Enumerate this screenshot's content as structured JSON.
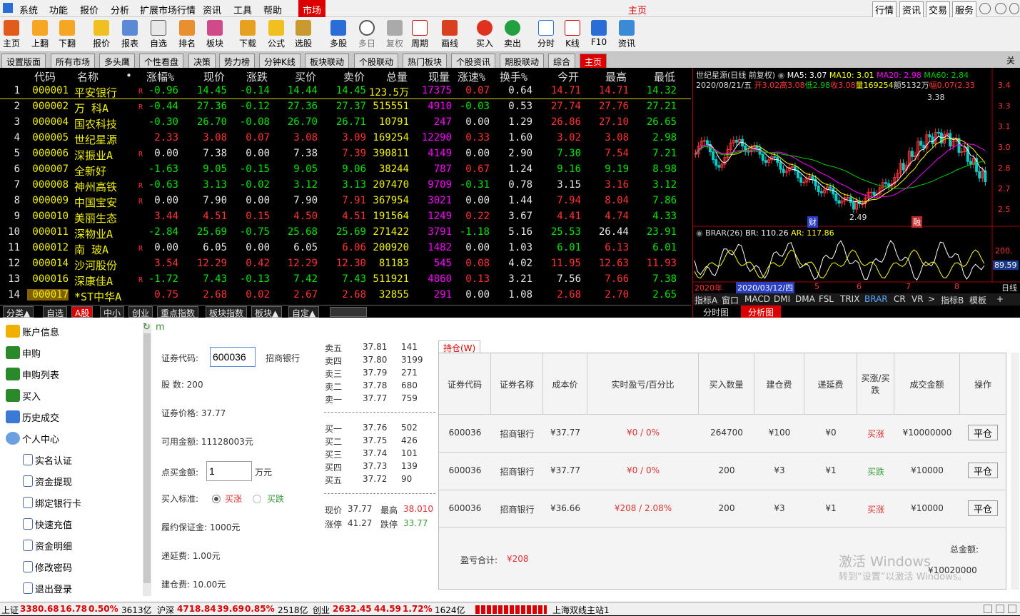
{
  "menu": [
    "系统",
    "功能",
    "报价",
    "分析",
    "扩展市场行情",
    "资讯",
    "工具",
    "帮助"
  ],
  "market_tab": "市场",
  "window_title": "主页",
  "right_menu": [
    "行情",
    "资讯",
    "交易",
    "服务"
  ],
  "toolbar": [
    "主页",
    "上翻",
    "下翻",
    "报价",
    "报表",
    "自选",
    "排名",
    "板块",
    "下载",
    "公式",
    "选股",
    "多股",
    "多日",
    "复权",
    "周期",
    "画线",
    "买入",
    "卖出",
    "分时",
    "K线",
    "F10",
    "资讯"
  ],
  "tabs": [
    "设置版面",
    "所有市场",
    "多头鹰",
    "个性看盘",
    "决策",
    "势力榜",
    "分钟K线",
    "板块联动",
    "个股联动",
    "热门板块",
    "个股资讯",
    "期股联动",
    "综合",
    "主页"
  ],
  "corner_label": "关",
  "grid": {
    "headers": [
      "代码",
      "名称",
      "•",
      "涨幅%",
      "现价",
      "涨跌",
      "买价",
      "卖价",
      "总量",
      "现量",
      "涨速%",
      "换手%",
      "今开",
      "最高",
      "最低"
    ],
    "rows": [
      {
        "n": "1",
        "code": "000001",
        "name": "平安银行",
        "r": "R",
        "pct": "-0.96",
        "price": "14.45",
        "chg": "-0.14",
        "bid": "14.44",
        "ask": "14.45",
        "vol": "123.5万",
        "cur": "17375",
        "spd": "0.07",
        "turn": "0.64",
        "open": "14.71",
        "high": "14.71",
        "low": "14.32"
      },
      {
        "n": "2",
        "code": "000002",
        "name": "万 科A",
        "r": "R",
        "pct": "-0.44",
        "price": "27.36",
        "chg": "-0.12",
        "bid": "27.36",
        "ask": "27.37",
        "vol": "515551",
        "cur": "4910",
        "spd": "-0.03",
        "turn": "0.53",
        "open": "27.74",
        "high": "27.76",
        "low": "27.21"
      },
      {
        "n": "3",
        "code": "000004",
        "name": "国农科技",
        "r": "",
        "pct": "-0.30",
        "price": "26.70",
        "chg": "-0.08",
        "bid": "26.70",
        "ask": "26.71",
        "vol": "10791",
        "cur": "247",
        "spd": "0.00",
        "turn": "1.29",
        "open": "26.86",
        "high": "27.10",
        "low": "26.65"
      },
      {
        "n": "4",
        "code": "000005",
        "name": "世纪星源",
        "r": "",
        "pct": "2.33",
        "price": "3.08",
        "chg": "0.07",
        "bid": "3.08",
        "ask": "3.09",
        "vol": "169254",
        "cur": "12290",
        "spd": "0.33",
        "turn": "1.60",
        "open": "3.02",
        "high": "3.08",
        "low": "2.98"
      },
      {
        "n": "5",
        "code": "000006",
        "name": "深振业A",
        "r": "R",
        "pct": "0.00",
        "price": "7.38",
        "chg": "0.00",
        "bid": "7.38",
        "ask": "7.39",
        "vol": "390811",
        "cur": "4149",
        "spd": "0.00",
        "turn": "2.90",
        "open": "7.30",
        "high": "7.54",
        "low": "7.21"
      },
      {
        "n": "6",
        "code": "000007",
        "name": "全新好",
        "r": "",
        "pct": "-1.63",
        "price": "9.05",
        "chg": "-0.15",
        "bid": "9.05",
        "ask": "9.06",
        "vol": "38244",
        "cur": "787",
        "spd": "0.67",
        "turn": "1.24",
        "open": "9.16",
        "high": "9.19",
        "low": "8.98"
      },
      {
        "n": "7",
        "code": "000008",
        "name": "神州高铁",
        "r": "R",
        "pct": "-0.63",
        "price": "3.13",
        "chg": "-0.02",
        "bid": "3.12",
        "ask": "3.13",
        "vol": "207470",
        "cur": "9709",
        "spd": "-0.31",
        "turn": "0.78",
        "open": "3.15",
        "high": "3.16",
        "low": "3.12"
      },
      {
        "n": "8",
        "code": "000009",
        "name": "中国宝安",
        "r": "R",
        "pct": "0.00",
        "price": "7.90",
        "chg": "0.00",
        "bid": "7.90",
        "ask": "7.91",
        "vol": "367954",
        "cur": "3021",
        "spd": "0.00",
        "turn": "1.44",
        "open": "7.94",
        "high": "8.04",
        "low": "7.86"
      },
      {
        "n": "9",
        "code": "000010",
        "name": "美丽生态",
        "r": "",
        "pct": "3.44",
        "price": "4.51",
        "chg": "0.15",
        "bid": "4.50",
        "ask": "4.51",
        "vol": "191564",
        "cur": "1249",
        "spd": "0.22",
        "turn": "3.67",
        "open": "4.41",
        "high": "4.74",
        "low": "4.33"
      },
      {
        "n": "10",
        "code": "000011",
        "name": "深物业A",
        "r": "",
        "pct": "-2.84",
        "price": "25.69",
        "chg": "-0.75",
        "bid": "25.68",
        "ask": "25.69",
        "vol": "271422",
        "cur": "3791",
        "spd": "-1.18",
        "turn": "5.16",
        "open": "25.53",
        "high": "26.44",
        "low": "23.91"
      },
      {
        "n": "11",
        "code": "000012",
        "name": "南 玻A",
        "r": "R",
        "pct": "0.00",
        "price": "6.05",
        "chg": "0.00",
        "bid": "6.05",
        "ask": "6.06",
        "vol": "200920",
        "cur": "1482",
        "spd": "0.00",
        "turn": "1.03",
        "open": "6.01",
        "high": "6.13",
        "low": "6.01"
      },
      {
        "n": "12",
        "code": "000014",
        "name": "沙河股份",
        "r": "",
        "pct": "3.54",
        "price": "12.29",
        "chg": "0.42",
        "bid": "12.29",
        "ask": "12.30",
        "vol": "81183",
        "cur": "545",
        "spd": "0.08",
        "turn": "4.02",
        "open": "11.95",
        "high": "12.63",
        "low": "11.93"
      },
      {
        "n": "13",
        "code": "000016",
        "name": "深康佳A",
        "r": "R",
        "pct": "-1.72",
        "price": "7.43",
        "chg": "-0.13",
        "bid": "7.42",
        "ask": "7.43",
        "vol": "511921",
        "cur": "4860",
        "spd": "0.13",
        "turn": "3.21",
        "open": "7.56",
        "high": "7.66",
        "low": "7.38"
      },
      {
        "n": "14",
        "code": "000017",
        "name": "*ST中华A",
        "r": "",
        "pct": "0.75",
        "price": "2.68",
        "chg": "0.02",
        "bid": "2.67",
        "ask": "2.68",
        "vol": "32855",
        "cur": "291",
        "spd": "0.00",
        "turn": "1.08",
        "open": "2.68",
        "high": "2.70",
        "low": "2.65"
      }
    ]
  },
  "bottom_tabs": [
    "分类▲",
    "自选",
    "A股",
    "中小",
    "创业",
    "重点指数",
    "板块指数",
    "板块▲",
    "自定▲"
  ],
  "chart": {
    "title": "世纪星源(日线 前复权)",
    "ma5": "MA5: 3.07",
    "ma10": "MA10: 3.01",
    "ma20": "MA20: 2.98",
    "ma60": "MA60: 2.84",
    "info_date": "2020/08/21/五",
    "info_open": "开3.02",
    "info_high": "高3.08",
    "info_low": "低2.98",
    "info_close": "收3.08",
    "info_vol": "量169254",
    "info_amt": "额5132万",
    "info_pct": "幅0.07(2.33",
    "max_label": "3.38",
    "min_label": "2.49",
    "mark1": "财",
    "mark2": "融",
    "yticks": [
      "3.4",
      "3.3",
      "3.1",
      "3.0",
      "2.8",
      "2.7",
      "2.5"
    ],
    "brar": "BRAR(26)",
    "br": "BR: 110.26",
    "ar": "AR: 117.86",
    "brar_tick": "200.",
    "brar_cur": "89.59",
    "xaxis": [
      "2020年",
      "2020/03/12/四",
      "5",
      "6",
      "7",
      "8"
    ],
    "xaxis_right": "日线",
    "ind_tabs": [
      "指标A",
      "窗口",
      "MACD",
      "DMI",
      "DMA",
      "FSL",
      "TRIX",
      "BRAR",
      "CR",
      "VR",
      ">",
      "指标B",
      "模板",
      "+"
    ],
    "view_tabs": [
      "分时图",
      "分析图"
    ]
  },
  "sidebar": [
    "账户信息",
    "申购",
    "申购列表",
    "买入",
    "历史成交",
    "个人中心",
    "实名认证",
    "资金提现",
    "绑定银行卡",
    "快速充值",
    "资金明细",
    "修改密码",
    "退出登录"
  ],
  "form": {
    "code_label": "证券代码:",
    "code_value": "600036",
    "code_name": "招商银行",
    "shares": "股 数:  200",
    "price": "证券价格:   37.77",
    "avail": "可用金额:   11128003元",
    "amount_label": "点买金额:",
    "amount_value": "1",
    "amount_unit": "万元",
    "std_label": "买入标准:",
    "std_up": "买涨",
    "std_down": "买跌",
    "deposit": "履约保证金:    1000元",
    "defer": "递延费:    1.00元",
    "build": "建仓费:    10.00元"
  },
  "orderbook": {
    "sell": [
      [
        "卖五",
        "37.81",
        "141"
      ],
      [
        "卖四",
        "37.80",
        "3199"
      ],
      [
        "卖三",
        "37.79",
        "271"
      ],
      [
        "卖二",
        "37.78",
        "680"
      ],
      [
        "卖一",
        "37.77",
        "759"
      ]
    ],
    "buy": [
      [
        "买一",
        "37.76",
        "502"
      ],
      [
        "买二",
        "37.75",
        "426"
      ],
      [
        "买三",
        "37.74",
        "101"
      ],
      [
        "买四",
        "37.73",
        "139"
      ],
      [
        "买五",
        "37.72",
        "90"
      ]
    ],
    "now_label": "现价",
    "now": "37.77",
    "high_label": "最高",
    "high": "38.010",
    "up_label": "涨停",
    "up": "41.27",
    "down_label": "跌停",
    "down": "33.77"
  },
  "positions": {
    "tab": "持仓(W)",
    "headers": [
      "证券代码",
      "证券名称",
      "成本价",
      "实时盈亏/百分比",
      "买入数量",
      "建仓费",
      "递延费",
      "买涨/买跌",
      "成交金额",
      "操作"
    ],
    "rows": [
      {
        "code": "600036",
        "name": "招商银行",
        "cost": "¥37.77",
        "pl": "¥0 / 0%",
        "qty": "264700",
        "build": "¥100",
        "defer": "¥0",
        "dir": "买涨",
        "amt": "¥10000000",
        "btn": "平仓"
      },
      {
        "code": "600036",
        "name": "招商银行",
        "cost": "¥37.77",
        "pl": "¥0 / 0%",
        "qty": "200",
        "build": "¥3",
        "defer": "¥1",
        "dir": "买跌",
        "amt": "¥10000",
        "btn": "平仓"
      },
      {
        "code": "600036",
        "name": "招商银行",
        "cost": "¥36.66",
        "pl": "¥208 / 2.08%",
        "qty": "200",
        "build": "¥3",
        "defer": "¥1",
        "dir": "买涨",
        "amt": "¥10000",
        "btn": "平仓"
      }
    ],
    "total_pl_label": "盈亏合计:",
    "total_pl": "¥208",
    "total_amt_label": "总金额:",
    "total_amt": "¥10020000"
  },
  "watermark1": "激活 Windows",
  "watermark2": "转到“设置”以激活 Windows。",
  "status": {
    "sh_label": "上证",
    "sh": "3380.68",
    "sh_chg": "16.78",
    "sh_pct": "0.50%",
    "sh_amt": "3613亿",
    "sz_label": "沪深",
    "sz": "4718.84",
    "sz_chg": "39.69",
    "sz_pct": "0.85%",
    "sz_amt": "2518亿",
    "cy_label": "创业",
    "cy": "2632.45",
    "cy_chg": "44.59",
    "cy_pct": "1.72%",
    "cy_amt": "1624亿",
    "server": "上海双线主站1"
  }
}
